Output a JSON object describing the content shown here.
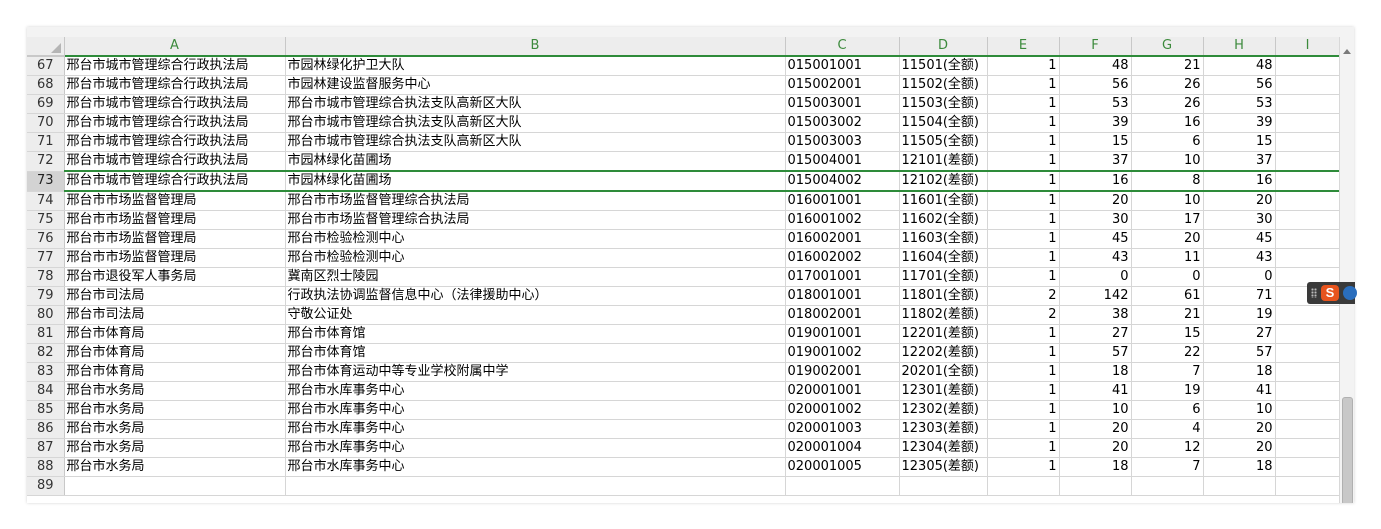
{
  "columns": [
    "A",
    "B",
    "C",
    "D",
    "E",
    "F",
    "G",
    "H",
    "I"
  ],
  "selected_row": "73",
  "rows": [
    {
      "n": "67",
      "a": "邢台市城市管理综合行政执法局",
      "b": "市园林绿化护卫大队",
      "c": "015001001",
      "d": "11501(全额)",
      "e": "1",
      "f": "48",
      "g": "21",
      "h": "48"
    },
    {
      "n": "68",
      "a": "邢台市城市管理综合行政执法局",
      "b": "市园林建设监督服务中心",
      "c": "015002001",
      "d": "11502(全额)",
      "e": "1",
      "f": "56",
      "g": "26",
      "h": "56"
    },
    {
      "n": "69",
      "a": "邢台市城市管理综合行政执法局",
      "b": "邢台市城市管理综合执法支队高新区大队",
      "c": "015003001",
      "d": "11503(全额)",
      "e": "1",
      "f": "53",
      "g": "26",
      "h": "53"
    },
    {
      "n": "70",
      "a": "邢台市城市管理综合行政执法局",
      "b": "邢台市城市管理综合执法支队高新区大队",
      "c": "015003002",
      "d": "11504(全额)",
      "e": "1",
      "f": "39",
      "g": "16",
      "h": "39"
    },
    {
      "n": "71",
      "a": "邢台市城市管理综合行政执法局",
      "b": "邢台市城市管理综合执法支队高新区大队",
      "c": "015003003",
      "d": "11505(全额)",
      "e": "1",
      "f": "15",
      "g": "6",
      "h": "15"
    },
    {
      "n": "72",
      "a": "邢台市城市管理综合行政执法局",
      "b": "市园林绿化苗圃场",
      "c": "015004001",
      "d": "12101(差额)",
      "e": "1",
      "f": "37",
      "g": "10",
      "h": "37"
    },
    {
      "n": "73",
      "a": "邢台市城市管理综合行政执法局",
      "b": "市园林绿化苗圃场",
      "c": "015004002",
      "d": "12102(差额)",
      "e": "1",
      "f": "16",
      "g": "8",
      "h": "16"
    },
    {
      "n": "74",
      "a": "邢台市市场监督管理局",
      "b": "邢台市市场监督管理综合执法局",
      "c": "016001001",
      "d": "11601(全额)",
      "e": "1",
      "f": "20",
      "g": "10",
      "h": "20"
    },
    {
      "n": "75",
      "a": "邢台市市场监督管理局",
      "b": "邢台市市场监督管理综合执法局",
      "c": "016001002",
      "d": "11602(全额)",
      "e": "1",
      "f": "30",
      "g": "17",
      "h": "30"
    },
    {
      "n": "76",
      "a": "邢台市市场监督管理局",
      "b": "邢台市检验检测中心",
      "c": "016002001",
      "d": "11603(全额)",
      "e": "1",
      "f": "45",
      "g": "20",
      "h": "45"
    },
    {
      "n": "77",
      "a": "邢台市市场监督管理局",
      "b": "邢台市检验检测中心",
      "c": "016002002",
      "d": "11604(全额)",
      "e": "1",
      "f": "43",
      "g": "11",
      "h": "43"
    },
    {
      "n": "78",
      "a": "邢台市退役军人事务局",
      "b": "冀南区烈士陵园",
      "c": "017001001",
      "d": "11701(全额)",
      "e": "1",
      "f": "0",
      "g": "0",
      "h": "0"
    },
    {
      "n": "79",
      "a": "邢台市司法局",
      "b": "行政执法协调监督信息中心（法律援助中心）",
      "c": "018001001",
      "d": "11801(全额)",
      "e": "2",
      "f": "142",
      "g": "61",
      "h": "71"
    },
    {
      "n": "80",
      "a": "邢台市司法局",
      "b": "守敬公证处",
      "c": "018002001",
      "d": "11802(差额)",
      "e": "2",
      "f": "38",
      "g": "21",
      "h": "19"
    },
    {
      "n": "81",
      "a": "邢台市体育局",
      "b": "邢台市体育馆",
      "c": "019001001",
      "d": "12201(差额)",
      "e": "1",
      "f": "27",
      "g": "15",
      "h": "27"
    },
    {
      "n": "82",
      "a": "邢台市体育局",
      "b": "邢台市体育馆",
      "c": "019001002",
      "d": "12202(差额)",
      "e": "1",
      "f": "57",
      "g": "22",
      "h": "57"
    },
    {
      "n": "83",
      "a": "邢台市体育局",
      "b": "邢台市体育运动中等专业学校附属中学",
      "c": "019002001",
      "d": "20201(全额)",
      "e": "1",
      "f": "18",
      "g": "7",
      "h": "18"
    },
    {
      "n": "84",
      "a": "邢台市水务局",
      "b": "邢台市水库事务中心",
      "c": "020001001",
      "d": "12301(差额)",
      "e": "1",
      "f": "41",
      "g": "19",
      "h": "41"
    },
    {
      "n": "85",
      "a": "邢台市水务局",
      "b": "邢台市水库事务中心",
      "c": "020001002",
      "d": "12302(差额)",
      "e": "1",
      "f": "10",
      "g": "6",
      "h": "10"
    },
    {
      "n": "86",
      "a": "邢台市水务局",
      "b": "邢台市水库事务中心",
      "c": "020001003",
      "d": "12303(差额)",
      "e": "1",
      "f": "20",
      "g": "4",
      "h": "20"
    },
    {
      "n": "87",
      "a": "邢台市水务局",
      "b": "邢台市水库事务中心",
      "c": "020001004",
      "d": "12304(差额)",
      "e": "1",
      "f": "20",
      "g": "12",
      "h": "20"
    },
    {
      "n": "88",
      "a": "邢台市水务局",
      "b": "邢台市水库事务中心",
      "c": "020001005",
      "d": "12305(差额)",
      "e": "1",
      "f": "18",
      "g": "7",
      "h": "18"
    },
    {
      "n": "89",
      "a": "",
      "b": "",
      "c": "",
      "d": "",
      "e": "",
      "f": "",
      "g": "",
      "h": ""
    }
  ],
  "ime_widget": {
    "brand_letter": "S",
    "icon": "sogou-ime-icon"
  },
  "colors": {
    "header_green": "#3c8a3c",
    "selection_border": "#2e8b3a",
    "header_bg": "#ededed"
  }
}
